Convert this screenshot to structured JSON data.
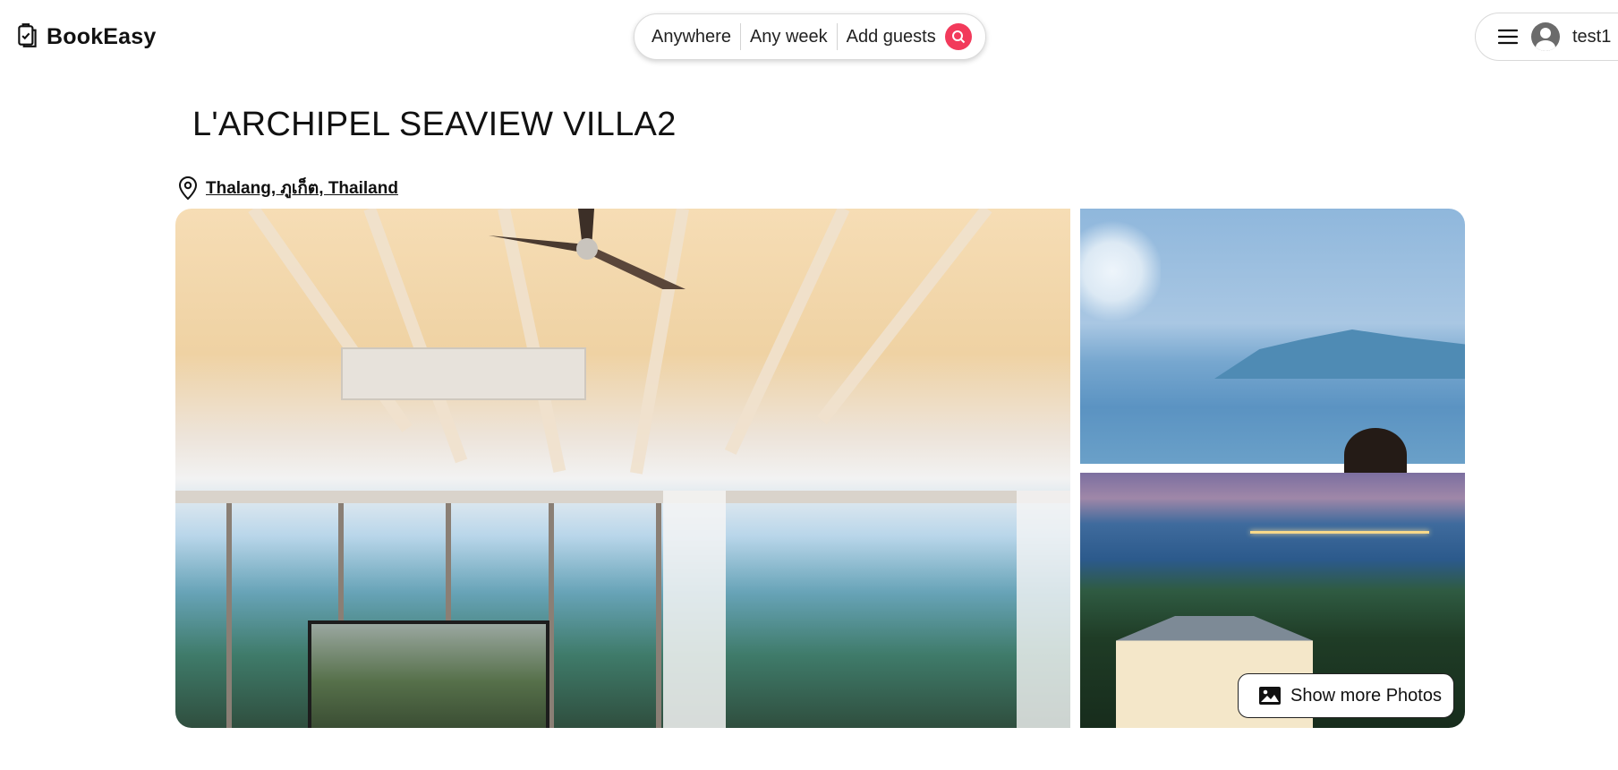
{
  "header": {
    "brand": "BookEasy",
    "search": {
      "where": "Anywhere",
      "when": "Any week",
      "who": "Add guests"
    },
    "user": {
      "name": "test1"
    }
  },
  "listing": {
    "title": "L'ARCHIPEL SEAVIEW VILLA2",
    "location": "Thalang, ภูเก็ต, Thailand",
    "show_more_label": "Show more Photos"
  },
  "colors": {
    "accent": "#f23a5b",
    "text": "#111111",
    "border": "#dadada"
  },
  "icons": {
    "logo": "clipboard-check-icon",
    "search": "search-icon",
    "menu": "hamburger-menu-icon",
    "avatar": "user-avatar-icon",
    "location": "map-pin-icon",
    "photos": "image-icon"
  }
}
